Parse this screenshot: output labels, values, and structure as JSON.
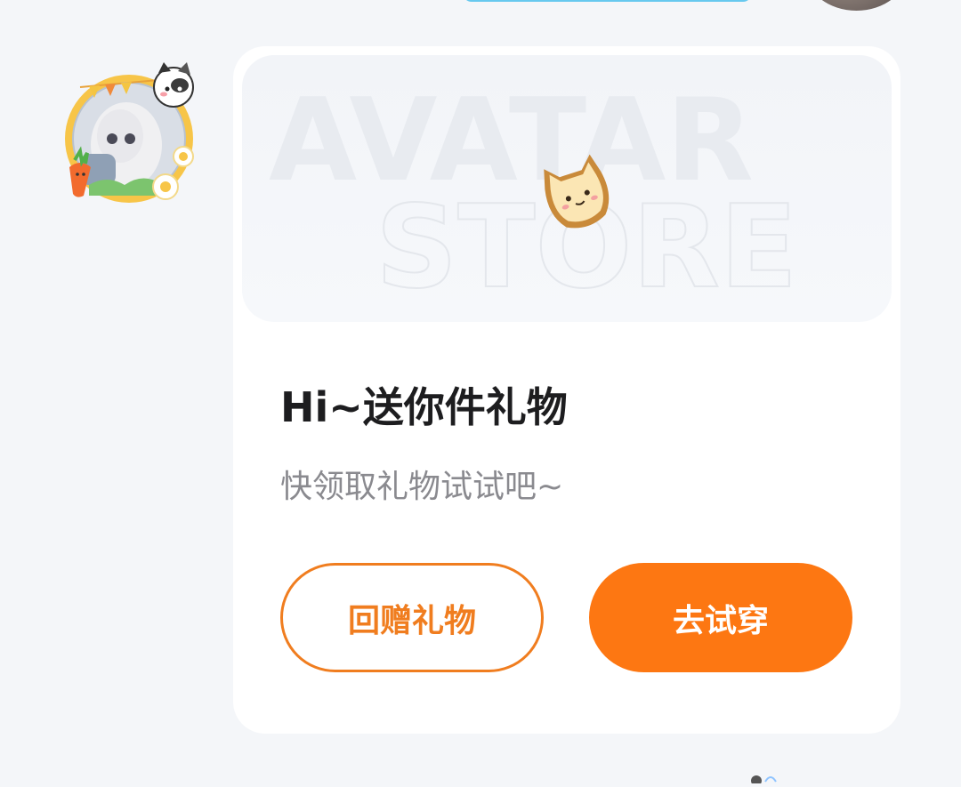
{
  "card": {
    "banner_text_line1": "AVATAR",
    "banner_text_line2": "STORE",
    "title": "Hi~送你件礼物",
    "subtitle": "快领取礼物试试吧~",
    "return_gift_label": "回赠礼物",
    "try_on_label": "去试穿"
  },
  "colors": {
    "accent": "#fd7712",
    "outline": "#f07d1f",
    "background": "#f4f6f9",
    "card": "#ffffff",
    "title": "#1d1d1f",
    "subtitle": "#8a8a8f"
  },
  "icons": {
    "cat": "cat-bread-icon",
    "avatar_frame": "avatar-frame-icon"
  }
}
